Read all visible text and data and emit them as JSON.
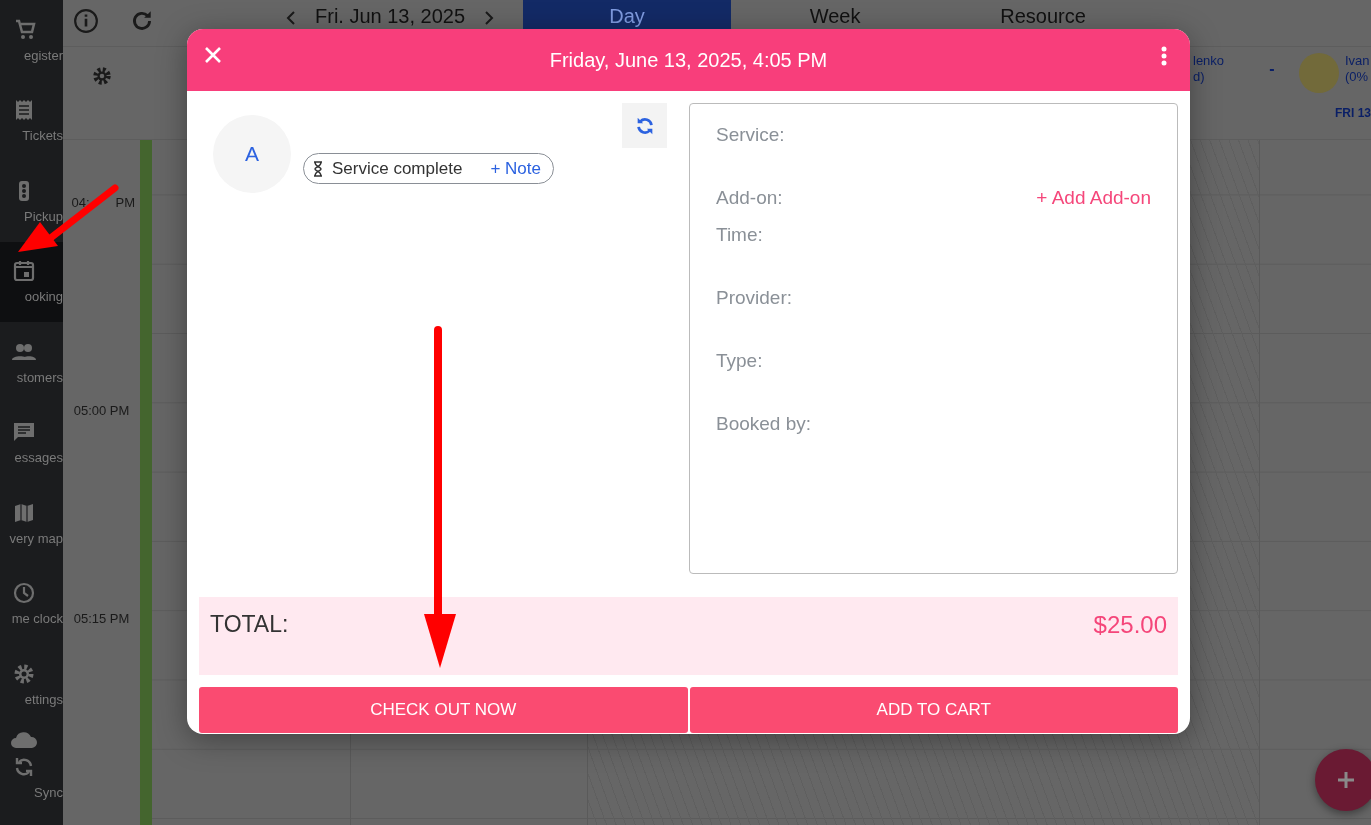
{
  "sidebar": {
    "items": [
      {
        "label": "egister",
        "selected": false
      },
      {
        "label": "Tickets",
        "selected": false
      },
      {
        "label": "Pickup",
        "selected": false
      },
      {
        "label": "ooking",
        "selected": true
      },
      {
        "label": "stomers",
        "selected": false
      },
      {
        "label": "essages",
        "selected": false
      },
      {
        "label": "very map",
        "selected": false
      },
      {
        "label": "me clock",
        "selected": false
      },
      {
        "label": "ettings",
        "selected": false
      },
      {
        "label": "Sync",
        "selected": false
      }
    ]
  },
  "top_bar": {
    "date": "Fri. Jun 13, 2025",
    "tabs": [
      {
        "label": "Day",
        "selected": true
      },
      {
        "label": "Week",
        "selected": false
      },
      {
        "label": "Resource",
        "selected": false
      }
    ]
  },
  "resource_header": {
    "column_1": [
      "lenko",
      "d)"
    ],
    "separator": "-",
    "column_2": [
      "Ivan",
      "(0%"
    ],
    "day_label": "FRI 13"
  },
  "covered_time": {
    "start": "04:",
    "end": "PM"
  },
  "times": [
    "05:00 PM",
    "05:15 PM"
  ],
  "modal": {
    "title": "Friday, June 13, 2025, 4:05 PM",
    "avatar_initial": "A",
    "status": "Service complete",
    "note_link": "+ Note",
    "details": [
      {
        "label": "Service:"
      },
      {
        "label": "Add-on:",
        "action": "+ Add Add-on"
      },
      {
        "label": "Time:"
      },
      {
        "label": "Provider:"
      },
      {
        "label": "Type:"
      },
      {
        "label": "Booked by:"
      }
    ],
    "total_label": "TOTAL:",
    "total": "$25.00",
    "buttons": [
      "CHECK OUT NOW",
      "ADD TO CART"
    ]
  }
}
